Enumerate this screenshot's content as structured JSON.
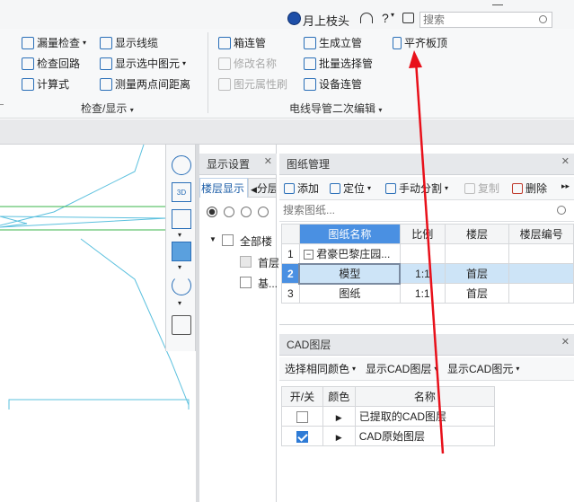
{
  "topbar": {
    "brand": "月上枝头",
    "help_icon": "?",
    "search_placeholder": "搜索"
  },
  "ribbon": {
    "check_group": {
      "label": "检查/显示",
      "items": [
        "漏量检查",
        "显示线缆",
        "检查回路",
        "显示选中图元",
        "计算式",
        "测量两点间距离"
      ]
    },
    "edit_group": {
      "label": "电线导管二次编辑",
      "items": [
        "箱连管",
        "生成立管",
        "平齐板顶",
        "修改名称",
        "批量选择管",
        "图元属性刷",
        "设备连管"
      ]
    }
  },
  "display_panel": {
    "title": "显示设置",
    "tabs": [
      "楼层显示",
      "分层"
    ],
    "tree": [
      "全部楼",
      "首层",
      "基..."
    ]
  },
  "drawing_panel": {
    "title": "图纸管理",
    "toolbar": [
      "添加",
      "定位",
      "手动分割",
      "复制",
      "删除"
    ],
    "search_placeholder": "搜索图纸...",
    "columns": [
      "图纸名称",
      "比例",
      "楼层",
      "楼层编号"
    ],
    "rows": [
      {
        "num": "1",
        "name": "君豪巴黎庄园...",
        "scale": "",
        "floor": "",
        "code": ""
      },
      {
        "num": "2",
        "name": "模型",
        "scale": "1:1",
        "floor": "首层",
        "code": ""
      },
      {
        "num": "3",
        "name": "图纸",
        "scale": "1:1",
        "floor": "首层",
        "code": ""
      }
    ]
  },
  "cad_panel": {
    "title": "CAD图层",
    "toolbar": [
      "选择相同颜色",
      "显示CAD图层",
      "显示CAD图元"
    ],
    "columns": [
      "开/关",
      "颜色",
      "名称"
    ],
    "rows": [
      {
        "name": "已提取的CAD图层",
        "checked": false
      },
      {
        "name": "CAD原始图层",
        "checked": true
      }
    ]
  },
  "colors": {
    "accent": "#2e7bd6",
    "selected_row": "#cde4f7",
    "header_cell": "#4a90e2",
    "arrow": "#e8101a"
  }
}
